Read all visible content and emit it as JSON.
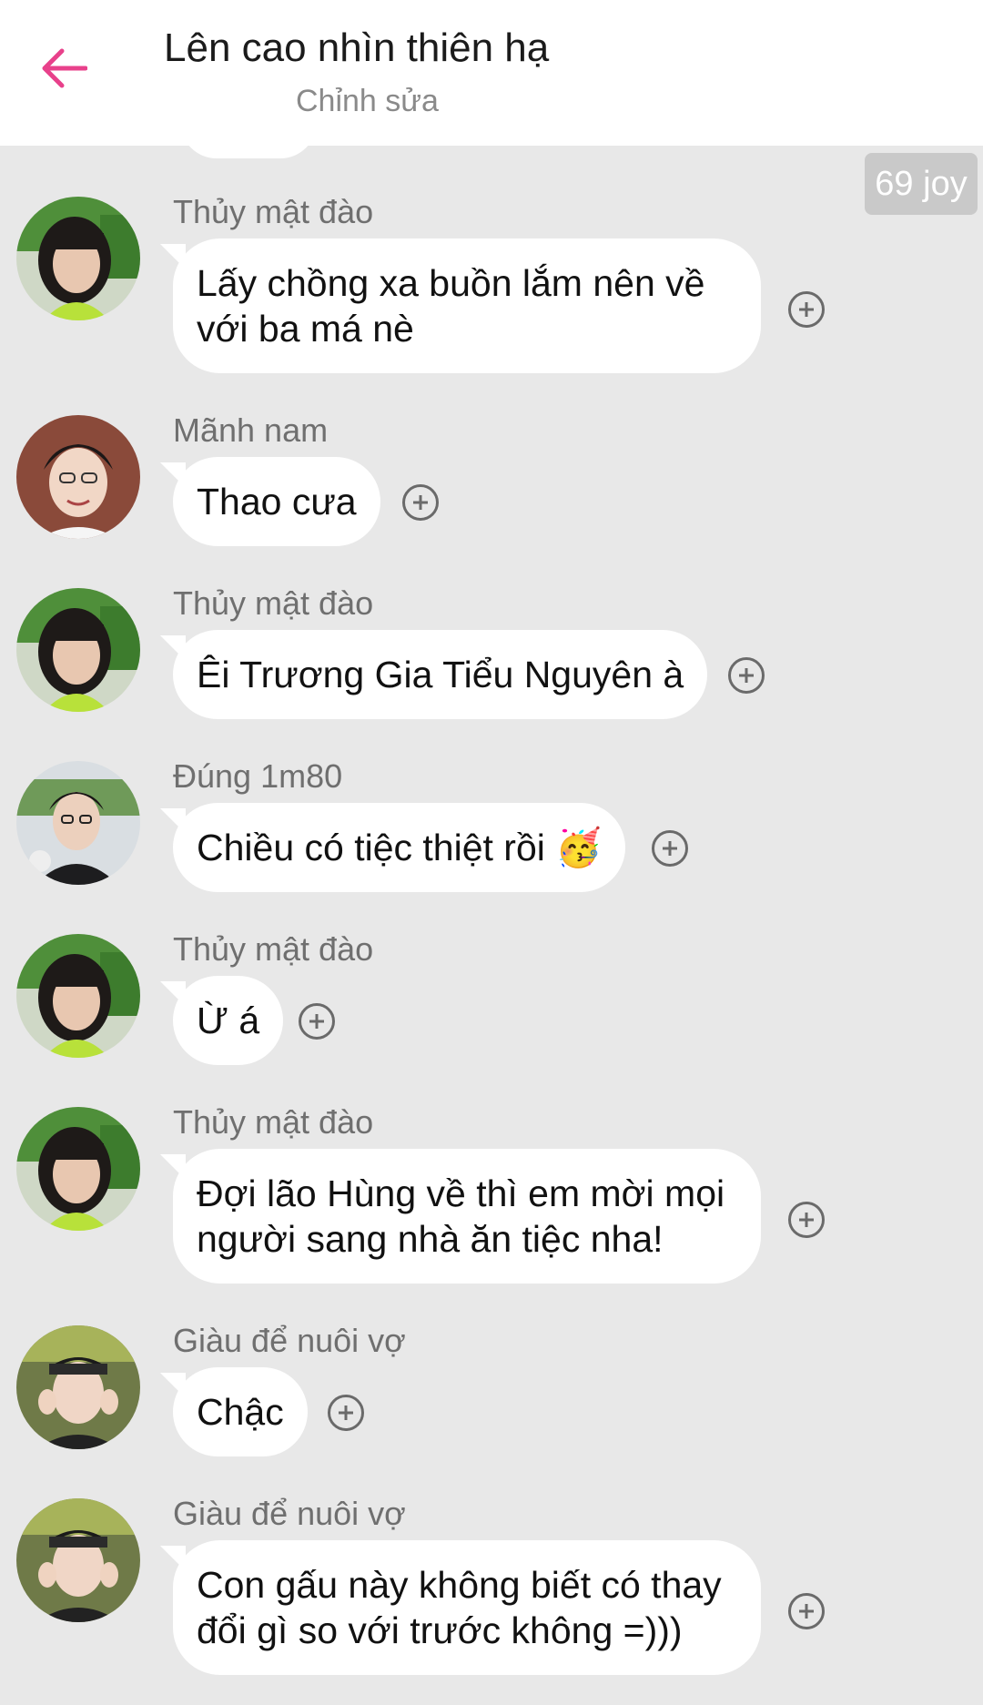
{
  "header": {
    "title": "Lên cao nhìn thiên hạ",
    "subtitle": "Chỉnh sửa",
    "accent_color": "#e8418b",
    "back_icon": "arrow-left-icon"
  },
  "badge": {
    "label": "69 joy"
  },
  "messages": [
    {
      "sender": "Thủy mật đào",
      "text": "Lấy chồng xa buồn lắm nên về với ba má nè",
      "avatar": "avatar-thuy-mat-dao"
    },
    {
      "sender": "Mãnh nam",
      "text": "Thao cưa",
      "avatar": "avatar-manh-nam"
    },
    {
      "sender": "Thủy mật đào",
      "text": "Êi Trương Gia Tiểu Nguyên à",
      "avatar": "avatar-thuy-mat-dao"
    },
    {
      "sender": "Đúng 1m80",
      "text": "Chiều có tiệc thiệt rồi 🥳",
      "avatar": "avatar-dung-1m80"
    },
    {
      "sender": "Thủy mật đào",
      "text": "Ừ á",
      "avatar": "avatar-thuy-mat-dao"
    },
    {
      "sender": "Thủy mật đào",
      "text": "Đợi lão Hùng về thì em mời mọi người sang nhà ăn tiệc nha!",
      "avatar": "avatar-thuy-mat-dao"
    },
    {
      "sender": "Giàu để nuôi vợ",
      "text": "Chậc",
      "avatar": "avatar-giau-de-nuoi-vo"
    },
    {
      "sender": "Giàu để nuôi vợ",
      "text": "Con gấu này không biết có thay đổi gì so với trước không =)))",
      "avatar": "avatar-giau-de-nuoi-vo"
    }
  ],
  "icons": {
    "reaction": "add-reaction-icon"
  }
}
